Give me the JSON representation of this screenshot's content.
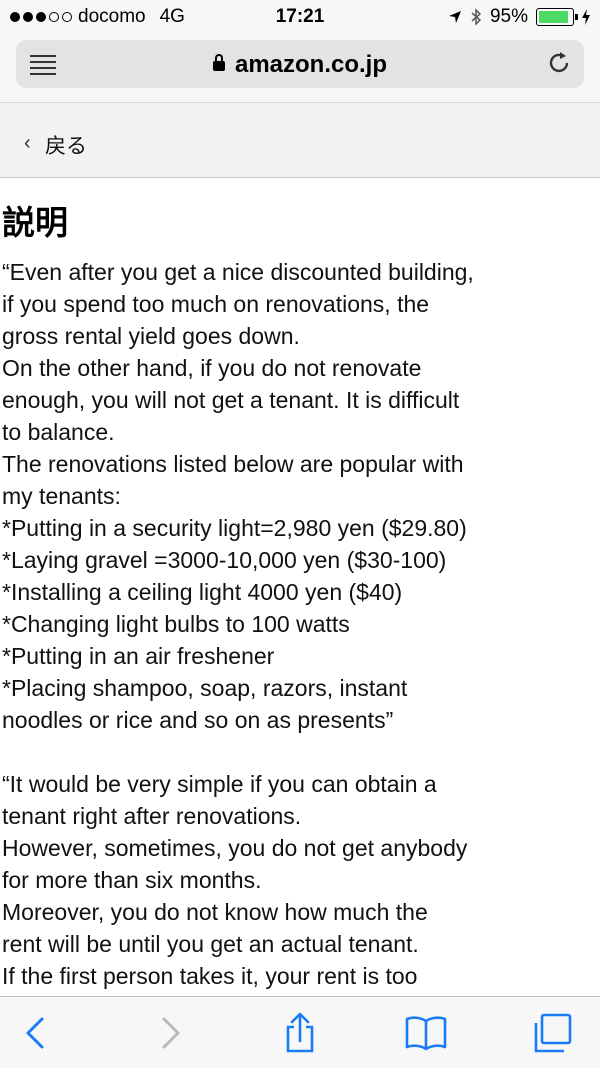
{
  "status_bar": {
    "carrier": "docomo",
    "network": "4G",
    "time": "17:21",
    "battery_percent": "95%",
    "battery_level": 0.95,
    "battery_color": "#4cd964"
  },
  "browser": {
    "url": "amazon.co.jp",
    "icons": [
      "reader-menu-icon",
      "lock-icon",
      "reload-icon"
    ]
  },
  "nav": {
    "back_label": "戻る"
  },
  "content": {
    "heading": "説明",
    "paragraph1": [
      "“Even after you get a nice discounted building,",
      "if you spend too much on renovations, the",
      "gross rental yield goes down.",
      "On the other hand, if you do not renovate",
      "enough, you will not get a tenant. It is difficult",
      "to balance.",
      "The renovations listed below are popular with",
      "my tenants:",
      "*Putting in a security light=2,980 yen ($29.80)",
      "*Laying gravel =3000-10,000 yen ($30-100)",
      "*Installing a ceiling light 4000 yen ($40)",
      "*Changing light bulbs to 100 watts",
      "*Putting in an air freshener",
      "*Placing shampoo, soap, razors, instant",
      "noodles or rice and so on as presents”"
    ],
    "paragraph2": [
      "“It would be very simple if you can obtain a",
      "tenant right after renovations.",
      "However, sometimes, you do not get anybody",
      "for more than six months.",
      "Moreover, you do not know how much the",
      "rent will be until you get an actual tenant.",
      "If the first person takes it, your rent is too"
    ]
  },
  "toolbar": {
    "accent": "#1a7cf5",
    "disabled": "#b8b8bd",
    "icons": [
      "back-arrow-icon",
      "forward-arrow-icon",
      "share-icon",
      "bookmarks-icon",
      "tabs-icon"
    ]
  }
}
